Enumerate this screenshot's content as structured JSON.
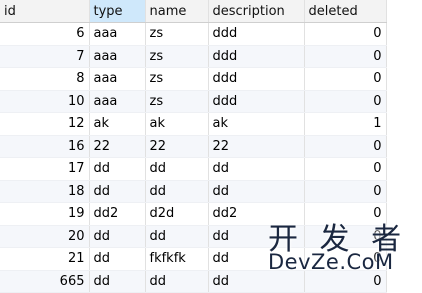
{
  "table": {
    "columns": [
      {
        "key": "id",
        "label": "id"
      },
      {
        "key": "type",
        "label": "type"
      },
      {
        "key": "name",
        "label": "name"
      },
      {
        "key": "description",
        "label": "description"
      },
      {
        "key": "deleted",
        "label": "deleted"
      }
    ],
    "sorted_column": "type",
    "rows": [
      {
        "id": "6",
        "type": "aaa",
        "name": "zs",
        "description": "ddd",
        "deleted": "0"
      },
      {
        "id": "7",
        "type": "aaa",
        "name": "zs",
        "description": "ddd",
        "deleted": "0"
      },
      {
        "id": "8",
        "type": "aaa",
        "name": "zs",
        "description": "ddd",
        "deleted": "0"
      },
      {
        "id": "10",
        "type": "aaa",
        "name": "zs",
        "description": "ddd",
        "deleted": "0"
      },
      {
        "id": "12",
        "type": "ak",
        "name": "ak",
        "description": "ak",
        "deleted": "1"
      },
      {
        "id": "16",
        "type": "22",
        "name": "22",
        "description": "22",
        "deleted": "0"
      },
      {
        "id": "17",
        "type": "dd",
        "name": "dd",
        "description": "dd",
        "deleted": "0"
      },
      {
        "id": "18",
        "type": "dd",
        "name": "dd",
        "description": "dd",
        "deleted": "0"
      },
      {
        "id": "19",
        "type": "dd2",
        "name": "d2d",
        "description": "dd2",
        "deleted": "0"
      },
      {
        "id": "20",
        "type": "dd",
        "name": "dd",
        "description": "dd",
        "deleted": "0"
      },
      {
        "id": "21",
        "type": "dd",
        "name": "fkfkfk",
        "description": "dd",
        "deleted": "0"
      },
      {
        "id": "665",
        "type": "dd",
        "name": "dd",
        "description": "dd",
        "deleted": "0"
      }
    ]
  },
  "watermark": {
    "chinese": "开 发 者",
    "brand": "DevZe.CoM"
  },
  "colors": {
    "header_bg": "#f3f3f3",
    "sorted_header_bg": "#cfe8fb",
    "alt_row_bg": "#f5f7fb"
  }
}
